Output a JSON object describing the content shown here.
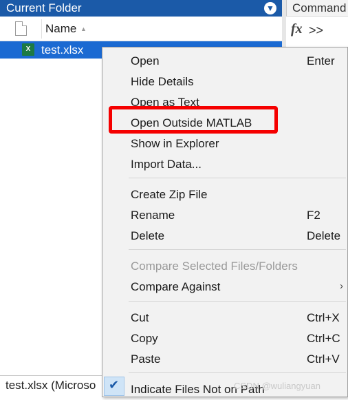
{
  "panels": {
    "current_folder_title": "Current Folder",
    "command_window_title": "Command"
  },
  "file_browser": {
    "column_name": "Name",
    "sort_indicator": "▲",
    "files": [
      {
        "name": "test.xlsx",
        "icon": "excel-file-icon",
        "selected": true
      }
    ]
  },
  "command_window": {
    "fx_label": "fx",
    "prompt": ">>"
  },
  "details": {
    "text": "test.xlsx  (Microso"
  },
  "context_menu": {
    "open": {
      "label": "Open",
      "shortcut": "Enter"
    },
    "hide_details": {
      "label": "Hide Details"
    },
    "open_as_text": {
      "label": "Open as Text"
    },
    "open_outside": {
      "label": "Open Outside MATLAB"
    },
    "show_in_explorer": {
      "label": "Show in Explorer"
    },
    "import_data": {
      "label": "Import Data..."
    },
    "create_zip": {
      "label": "Create Zip File"
    },
    "rename": {
      "label": "Rename",
      "shortcut": "F2"
    },
    "delete": {
      "label": "Delete",
      "shortcut": "Delete"
    },
    "compare_selected": {
      "label": "Compare Selected Files/Folders",
      "disabled": true
    },
    "compare_against": {
      "label": "Compare Against",
      "submenu_arrow": "›"
    },
    "cut": {
      "label": "Cut",
      "shortcut": "Ctrl+X"
    },
    "copy": {
      "label": "Copy",
      "shortcut": "Ctrl+C"
    },
    "paste": {
      "label": "Paste",
      "shortcut": "Ctrl+V"
    },
    "indicate_not_on_path": {
      "label": "Indicate Files Not on Path",
      "checked": true
    }
  },
  "annotation": {
    "highlight_color": "#f50000"
  },
  "watermark": "CSDN @wuliangyuan",
  "colors": {
    "panel_header": "#1b5aa8",
    "selection": "#1b6ad2",
    "menu_bg": "#f2f2f2"
  }
}
